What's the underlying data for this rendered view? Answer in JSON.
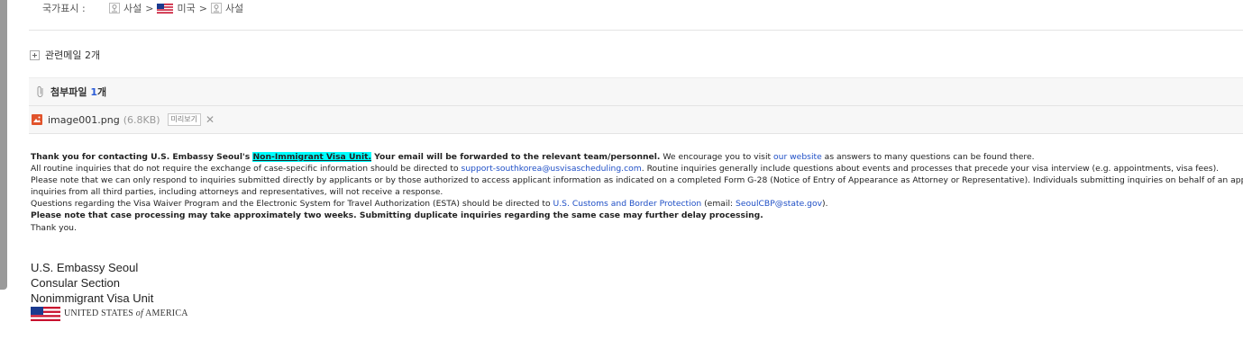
{
  "country": {
    "label": "국가표시 :",
    "path": [
      {
        "icon": "globe-icon",
        "text": "사설"
      },
      {
        "separator": ">"
      },
      {
        "icon": "us-flag-icon",
        "text": "미국"
      },
      {
        "separator": ">"
      },
      {
        "icon": "globe-icon",
        "text": "사설"
      }
    ]
  },
  "related": {
    "label": "관련메일 2개"
  },
  "attachments": {
    "header_label": "첨부파일",
    "count": "1",
    "count_suffix": "개",
    "file": {
      "name": "image001.png",
      "size": "(6.8KB)",
      "preview_label": "미리보기",
      "remove": "✕"
    }
  },
  "body": {
    "p1_a": "Thank you for contacting U.S. Embassy Seoul's ",
    "p1_hl": "Non-Immigrant Visa Unit.",
    "p1_b": "  Your email will be forwarded to the relevant team/personnel.",
    "p1_c": "  We encourage you to visit ",
    "p1_link": "our website",
    "p1_d": " as answers to many questions can be found there.",
    "p2_a": "All routine inquiries that do not require the exchange of case-specific information should be directed to ",
    "p2_link": "support-southkorea@usvisascheduling.com",
    "p2_b": ". Routine inquiries generally include questions about events and processes that precede your visa interview (e.g. appointments, visa fees).",
    "p3_a": "Please note that we can only respond to inquiries submitted directly by applicants or by those authorized to access applicant information as indicated on a completed Form G-28 (Notice of Entry of Appearance as Attorney or Representative).  Individuals submitting inquiries on behalf of an appli",
    "p3_b": "inquiries from all third parties, including attorneys and representatives, will not receive a response.",
    "p4_a": "Questions regarding the Visa Waiver Program and the Electronic System for Travel Authorization (ESTA) should be directed to ",
    "p4_link": "U.S. Customs and Border Protection",
    "p4_b": " (email: ",
    "p4_email": "SeoulCBP@state.gov",
    "p4_c": ").",
    "p5": "Please note that case processing may take approximately two weeks. Submitting duplicate inquiries regarding the same case may further delay processing.",
    "p6": "Thank you."
  },
  "signature": {
    "line1": "U.S. Embassy Seoul",
    "line2": "Consular Section",
    "line3": "Nonimmigrant Visa Unit",
    "country_a": "UNITED STATES ",
    "country_of": "of",
    "country_b": " AMERICA"
  }
}
